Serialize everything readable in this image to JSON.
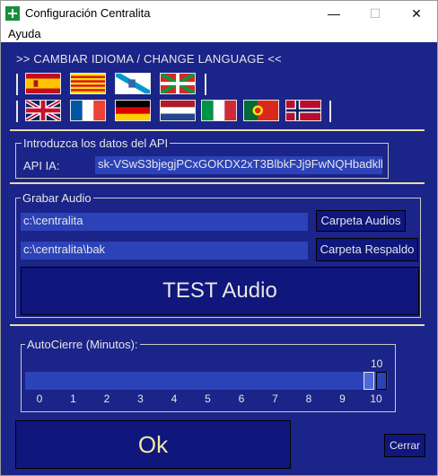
{
  "window": {
    "title": "Configuración Centralita",
    "minimize_glyph": "—",
    "maximize_glyph": "☐",
    "close_glyph": "✕"
  },
  "menu": {
    "items": [
      "Ayuda"
    ]
  },
  "language": {
    "link_text": ">> CAMBIAR IDIOMA / CHANGE LANGUAGE <<",
    "row1": [
      "spain-flag",
      "catalonia-flag",
      "galicia-flag",
      "basque-flag"
    ],
    "row2": [
      "uk-flag",
      "france-flag",
      "germany-flag",
      "netherlands-flag",
      "italy-flag",
      "portugal-flag",
      "norway-flag"
    ]
  },
  "api": {
    "group_label": "Introduzca los datos del API",
    "field_label": "API IA:",
    "field_value": "sk-VSwS3bjegjPCxGOKDX2xT3BlbkFJj9FwNQHbadkll"
  },
  "audio": {
    "group_label": "Grabar Audio",
    "audio_path": "c:\\centralita",
    "backup_path": "c:\\centralita\\bak",
    "audio_folder_button": "Carpeta Audios",
    "backup_folder_button": "Carpeta Respaldo",
    "test_button": "TEST Audio"
  },
  "autoclose": {
    "group_label": "AutoCierre (Minutos):",
    "current_value": "10",
    "value_fraction": 1.0,
    "ticks": [
      "0",
      "1",
      "2",
      "3",
      "4",
      "5",
      "6",
      "7",
      "8",
      "9",
      "10"
    ]
  },
  "footer": {
    "ok_button": "Ok",
    "close_button": "Cerrar"
  },
  "colors": {
    "background": "#1b2488",
    "field": "#2c42b8",
    "button": "#0f167c",
    "separator": "#e9dca6",
    "ok_text": "#f0e6a0"
  }
}
